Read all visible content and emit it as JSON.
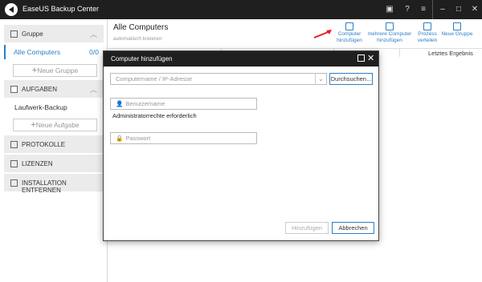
{
  "window": {
    "title": "EaseUS Backup Center"
  },
  "sidebar": {
    "groups_header": "Gruppe",
    "all_computers_label": "Alle Computers",
    "all_computers_count": "0/0",
    "new_group_label": "Neue Gruppe",
    "tasks_header": "AUFGABEN",
    "task_item": "Laufwerk-Backup",
    "new_task_label": "Neue Aufgabe",
    "logs_label": "PROTOKOLLE",
    "licenses_label": "LIZENZEN",
    "uninstall_label": "INSTALLATION ENTFERNEN"
  },
  "main": {
    "title": "Alle Computers",
    "subtitle": "automatisch kreieren",
    "toolbar": [
      {
        "line1": "Computer",
        "line2": "hinzufügen",
        "icon": "monitor-icon"
      },
      {
        "line1": "mehrere Computer",
        "line2": "hinzufügen",
        "icon": "multi-monitor-icon"
      },
      {
        "line1": "Prozess",
        "line2": "verteilen",
        "icon": "deploy-icon"
      },
      {
        "line1": "Neue Gruppe",
        "line2": "",
        "icon": "new-group-icon"
      }
    ],
    "column_last_result": "Letztes Ergebnis"
  },
  "dialog": {
    "title": "Computer hinzufügen",
    "computer_placeholder": "Computername / IP-Adresse",
    "browse_label": "Durchsuchen...",
    "username_placeholder": "Benutzername",
    "admin_note": "Administratorrechte erforderlich",
    "password_placeholder": "Passwort",
    "add_label": "Hinzufügen",
    "cancel_label": "Abbrechen"
  },
  "colors": {
    "accent": "#2b7fc9",
    "titlebar": "#1f1f1f",
    "arrow": "#e02020"
  }
}
